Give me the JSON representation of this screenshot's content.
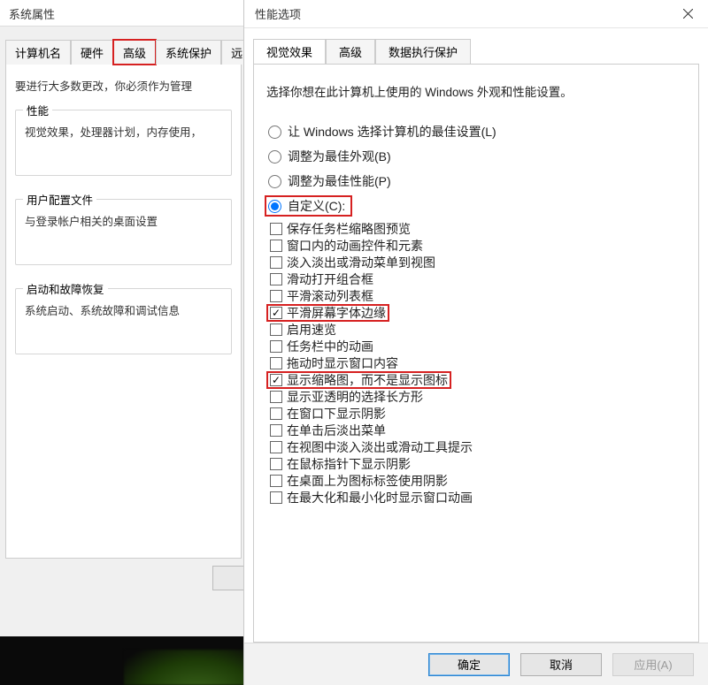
{
  "sysprops": {
    "title": "系统属性",
    "tabs": [
      "计算机名",
      "硬件",
      "高级",
      "系统保护",
      "远"
    ],
    "highlighted_tab_index": 2,
    "hint": "要进行大多数更改，你必须作为管理",
    "groups": {
      "performance": {
        "legend": "性能",
        "line": "视觉效果，处理器计划，内存使用，"
      },
      "userprofile": {
        "legend": "用户配置文件",
        "line": "与登录帐户相关的桌面设置"
      },
      "startup": {
        "legend": "启动和故障恢复",
        "line": "系统启动、系统故障和调试信息"
      }
    }
  },
  "perf": {
    "title": "性能选项",
    "tabs": [
      "视觉效果",
      "高级",
      "数据执行保护"
    ],
    "active_tab_index": 0,
    "hint": "选择你想在此计算机上使用的 Windows 外观和性能设置。",
    "radios": [
      {
        "label": "让 Windows 选择计算机的最佳设置(L)",
        "checked": false,
        "highlighted": false
      },
      {
        "label": "调整为最佳外观(B)",
        "checked": false,
        "highlighted": false
      },
      {
        "label": "调整为最佳性能(P)",
        "checked": false,
        "highlighted": false
      },
      {
        "label": "自定义(C):",
        "checked": true,
        "highlighted": true
      }
    ],
    "checks": [
      {
        "label": "保存任务栏缩略图预览",
        "checked": false,
        "highlighted": false
      },
      {
        "label": "窗口内的动画控件和元素",
        "checked": false,
        "highlighted": false
      },
      {
        "label": "淡入淡出或滑动菜单到视图",
        "checked": false,
        "highlighted": false
      },
      {
        "label": "滑动打开组合框",
        "checked": false,
        "highlighted": false
      },
      {
        "label": "平滑滚动列表框",
        "checked": false,
        "highlighted": false
      },
      {
        "label": "平滑屏幕字体边缘",
        "checked": true,
        "highlighted": true
      },
      {
        "label": "启用速览",
        "checked": false,
        "highlighted": false
      },
      {
        "label": "任务栏中的动画",
        "checked": false,
        "highlighted": false
      },
      {
        "label": "拖动时显示窗口内容",
        "checked": false,
        "highlighted": false
      },
      {
        "label": "显示缩略图，而不是显示图标",
        "checked": true,
        "highlighted": true
      },
      {
        "label": "显示亚透明的选择长方形",
        "checked": false,
        "highlighted": false
      },
      {
        "label": "在窗口下显示阴影",
        "checked": false,
        "highlighted": false
      },
      {
        "label": "在单击后淡出菜单",
        "checked": false,
        "highlighted": false
      },
      {
        "label": "在视图中淡入淡出或滑动工具提示",
        "checked": false,
        "highlighted": false
      },
      {
        "label": "在鼠标指针下显示阴影",
        "checked": false,
        "highlighted": false
      },
      {
        "label": "在桌面上为图标标签使用阴影",
        "checked": false,
        "highlighted": false
      },
      {
        "label": "在最大化和最小化时显示窗口动画",
        "checked": false,
        "highlighted": false
      }
    ],
    "buttons": {
      "ok": "确定",
      "cancel": "取消",
      "apply": "应用(A)"
    }
  }
}
